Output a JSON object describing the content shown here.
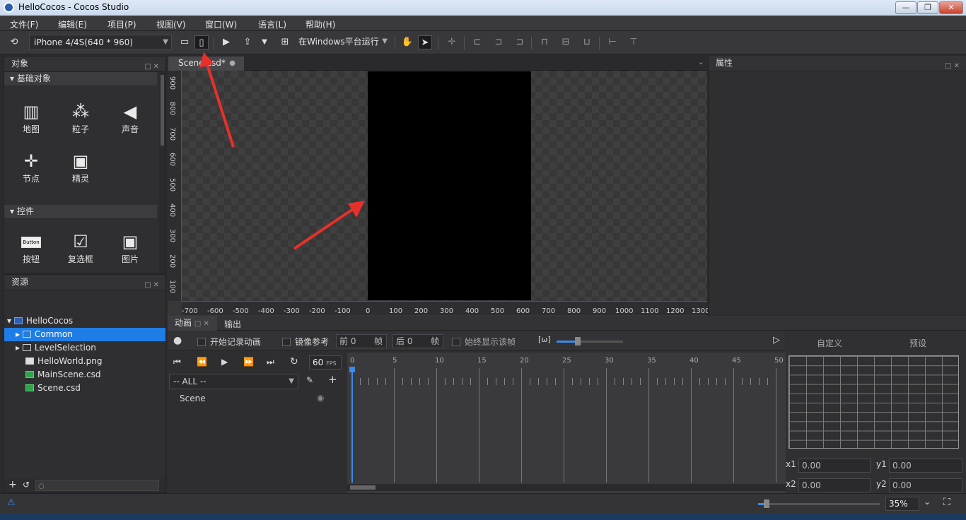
{
  "window": {
    "title": "HelloCocos - Cocos Studio",
    "min": "—",
    "max": "❐",
    "close": "✕"
  },
  "menu": [
    "文件(F)",
    "编辑(E)",
    "项目(P)",
    "视图(V)",
    "窗口(W)",
    "语言(L)",
    "帮助(H)"
  ],
  "toolbar": {
    "device": "iPhone 4/4S(640 * 960)",
    "run_target": "在Windows平台运行"
  },
  "objects_panel": {
    "title": "对象",
    "basic_section": "基础对象",
    "basic_items": [
      {
        "label": "地图",
        "icon": "map-icon"
      },
      {
        "label": "粒子",
        "icon": "particle-icon"
      },
      {
        "label": "声音",
        "icon": "sound-icon"
      },
      {
        "label": "节点",
        "icon": "node-icon"
      },
      {
        "label": "精灵",
        "icon": "sprite-icon"
      }
    ],
    "controls_section": "控件",
    "control_items": [
      {
        "label": "按钮",
        "icon": "button-icon",
        "glyph": "Button"
      },
      {
        "label": "复选框",
        "icon": "checkbox-icon"
      },
      {
        "label": "图片",
        "icon": "image-icon"
      }
    ]
  },
  "resources_panel": {
    "title": "资源",
    "tree": [
      {
        "label": "HelloCocos",
        "type": "project",
        "level": 0,
        "expanded": true
      },
      {
        "label": "Common",
        "type": "folder",
        "level": 1,
        "selected": true
      },
      {
        "label": "LevelSelection",
        "type": "folder",
        "level": 1
      },
      {
        "label": "HelloWorld.png",
        "type": "image",
        "level": 1
      },
      {
        "label": "MainScene.csd",
        "type": "csd",
        "level": 1
      },
      {
        "label": "Scene.csd",
        "type": "csd",
        "level": 1
      }
    ]
  },
  "scene": {
    "tab": "Scene.csd*",
    "hruler": [
      "-700",
      "-600",
      "-500",
      "-400",
      "-300",
      "-200",
      "-100",
      "0",
      "100",
      "200",
      "300",
      "400",
      "500",
      "600",
      "700",
      "800",
      "900",
      "1000",
      "1100",
      "1200",
      "1300"
    ],
    "vruler": [
      "900",
      "800",
      "700",
      "600",
      "500",
      "400",
      "300",
      "200",
      "100"
    ]
  },
  "properties_panel": {
    "title": "属性"
  },
  "animation_panel": {
    "tab_anim": "动画",
    "tab_output": "输出",
    "record": "开始记录动画",
    "mirror": "镜像参考",
    "before_label": "前",
    "before_value": "0",
    "after_label": "后",
    "after_value": "0",
    "frame_unit": "帧",
    "always_show": "始终显示该帧",
    "fps_value": "60",
    "fps_unit": "FPS",
    "filter": "-- ALL --",
    "scene_row": "Scene",
    "timeline_marks": [
      "0",
      "5",
      "10",
      "15",
      "20",
      "25",
      "30",
      "35",
      "40",
      "45",
      "50"
    ],
    "custom_tab": "自定义",
    "preset_tab": "预设",
    "x1_label": "x1",
    "x1": "0.00",
    "y1_label": "y1",
    "y1": "0.00",
    "x2_label": "x2",
    "x2": "0.00",
    "y2_label": "y2",
    "y2": "0.00"
  },
  "status": {
    "zoom": "35%"
  }
}
